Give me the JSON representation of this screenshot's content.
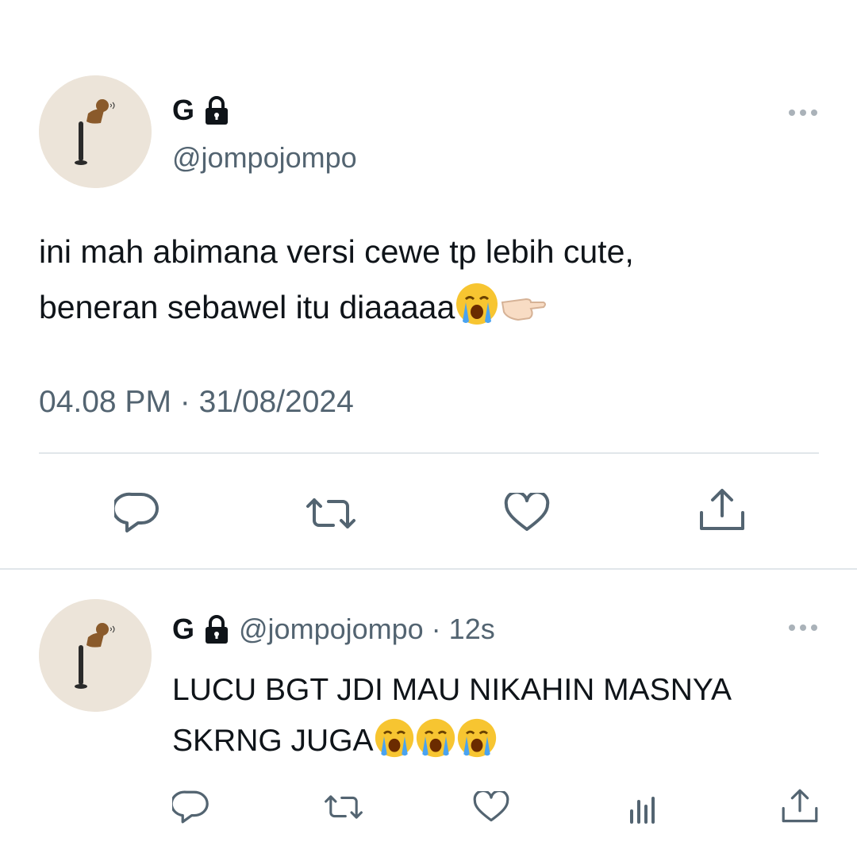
{
  "main_tweet": {
    "author_name": "G",
    "handle": "@jompojompo",
    "text_line1": "ini mah abimana versi cewe tp lebih cute,",
    "text_line2": "beneran sebawel itu diaaaaa",
    "time": "04.08 PM",
    "separator": "·",
    "date": "31/08/2024",
    "actions": [
      "reply-icon",
      "retweet-icon",
      "like-icon",
      "share-icon"
    ]
  },
  "reply_tweet": {
    "author_name": "G",
    "handle": "@jompojompo",
    "separator": "·",
    "time_ago": "12s",
    "text_line1": "LUCU BGT JDI MAU NIKAHIN MASNYA",
    "text_line2": "SKRNG JUGA",
    "actions": [
      "reply-icon",
      "retweet-icon",
      "like-icon",
      "views-icon",
      "share-icon"
    ]
  },
  "colors": {
    "text": "#0f1419",
    "secondary": "#536471",
    "divider": "#e1e6ea",
    "avatar_bg": "#ece4d9"
  }
}
